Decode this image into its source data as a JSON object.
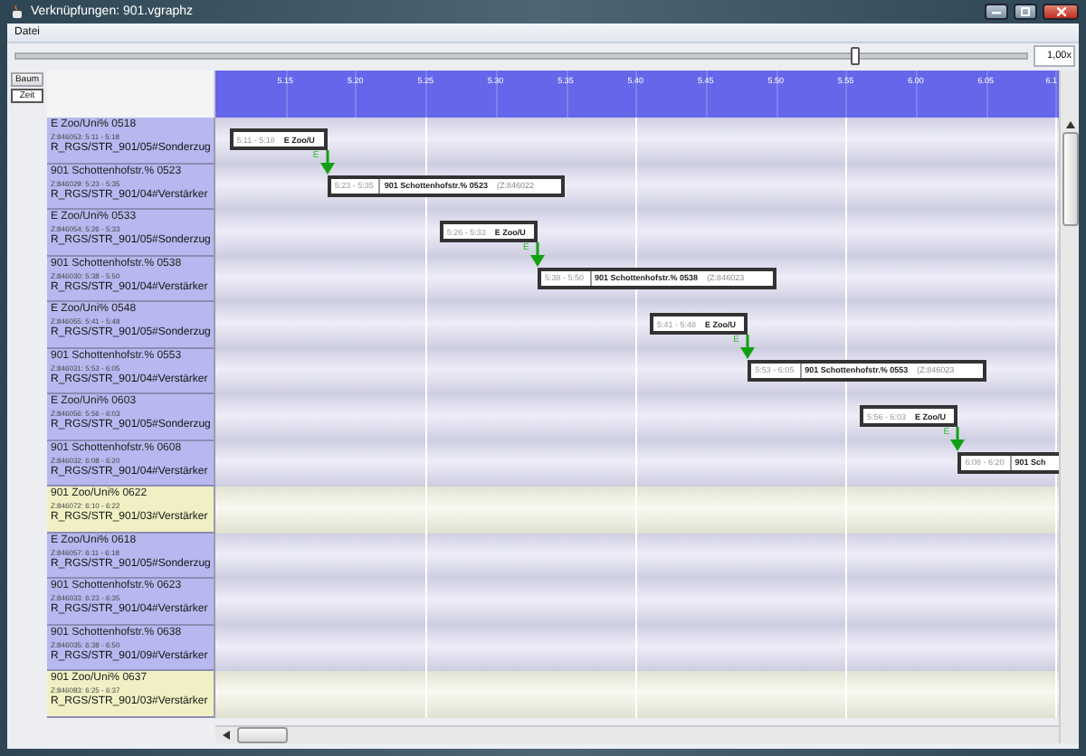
{
  "window": {
    "title": "Verknüpfungen: 901.vgraphz"
  },
  "menu": [
    "Datei"
  ],
  "zoom": {
    "level": 0.83,
    "value": "1,00x"
  },
  "view_tabs": [
    {
      "label": "Baum",
      "selected": false
    },
    {
      "label": "Zeit",
      "selected": true
    }
  ],
  "timeline": {
    "ticks": [
      "5.15",
      "5.20",
      "5.25",
      "5.30",
      "5.35",
      "5.40",
      "5.45",
      "5.50",
      "5.55",
      "6.00",
      "6.05",
      "6.1"
    ]
  },
  "rows": [
    {
      "name": "E Zoo/Uni% 0518",
      "train": "Z:846053: 5:11 - 5:18",
      "route": "R_RGS/STR_901/05#Sonderzug",
      "color": "#b8b8f0",
      "block": {
        "time": "5:11 - 5:18",
        "name": "E Zoo/U",
        "link": {
          "label": "E"
        }
      }
    },
    {
      "name": "901 Schottenhofstr.% 0523",
      "train": "Z:846029: 5:23 - 5:35",
      "route": "R_RGS/STR_901/04#Verstärker",
      "color": "#b8b8f0",
      "block": {
        "time": "5:23 - 5:35",
        "name": "901 Schottenhofstr.% 0523",
        "zug": "(Z:846022"
      }
    },
    {
      "name": "E Zoo/Uni% 0533",
      "train": "Z:846054: 5:26 - 5:33",
      "route": "R_RGS/STR_901/05#Sonderzug",
      "color": "#b8b8f0",
      "block": {
        "time": "5:26 - 5:33",
        "name": "E Zoo/U",
        "link": {
          "label": "E"
        }
      }
    },
    {
      "name": "901 Schottenhofstr.% 0538",
      "train": "Z:846030: 5:38 - 5:50",
      "route": "R_RGS/STR_901/04#Verstärker",
      "color": "#b8b8f0",
      "block": {
        "time": "5:38 - 5:50",
        "name": "901 Schottenhofstr.% 0538",
        "zug": "(Z:846023"
      }
    },
    {
      "name": "E Zoo/Uni% 0548",
      "train": "Z:846055: 5:41 - 5:48",
      "route": "R_RGS/STR_901/05#Sonderzug",
      "color": "#b8b8f0",
      "block": {
        "time": "5:41 - 5:48",
        "name": "E Zoo/U",
        "link": {
          "label": "E"
        }
      }
    },
    {
      "name": "901 Schottenhofstr.% 0553",
      "train": "Z:846031: 5:53 - 6:05",
      "route": "R_RGS/STR_901/04#Verstärker",
      "color": "#b8b8f0",
      "block": {
        "time": "5:53 - 6:05",
        "name": "901 Schottenhofstr.% 0553",
        "zug": "(Z:846023"
      }
    },
    {
      "name": "E Zoo/Uni% 0603",
      "train": "Z:846056: 5:56 - 6:03",
      "route": "R_RGS/STR_901/05#Sonderzug",
      "color": "#b8b8f0",
      "block": {
        "time": "5:56 - 6:03",
        "name": "E Zoo/U",
        "link": {
          "label": "E"
        }
      }
    },
    {
      "name": "901 Schottenhofstr.% 0608",
      "train": "Z:846032: 6:08 - 6:20",
      "route": "R_RGS/STR_901/04#Verstärker",
      "color": "#b8b8f0",
      "block": {
        "time": "6:08 - 6:20",
        "name": "901 Sch"
      }
    },
    {
      "name": "901 Zoo/Uni% 0622",
      "train": "Z:846072: 6:10 - 6:22",
      "route": "R_RGS/STR_901/03#Verstärker",
      "color": "#f0f0c4"
    },
    {
      "name": "E Zoo/Uni% 0618",
      "train": "Z:846057: 6:11 - 6:18",
      "route": "R_RGS/STR_901/05#Sonderzug",
      "color": "#b8b8f0"
    },
    {
      "name": "901 Schottenhofstr.% 0623",
      "train": "Z:846033: 6:23 - 6:35",
      "route": "R_RGS/STR_901/04#Verstärker",
      "color": "#b8b8f0"
    },
    {
      "name": "901 Schottenhofstr.% 0638",
      "train": "Z:846035: 6:38 - 6:50",
      "route": "R_RGS/STR_901/09#Verstärker",
      "color": "#b8b8f0"
    },
    {
      "name": "901 Zoo/Uni% 0637",
      "train": "Z:846083: 6:25 - 6:37",
      "route": "R_RGS/STR_901/03#Verstärker",
      "color": "#f0f0c4"
    }
  ]
}
